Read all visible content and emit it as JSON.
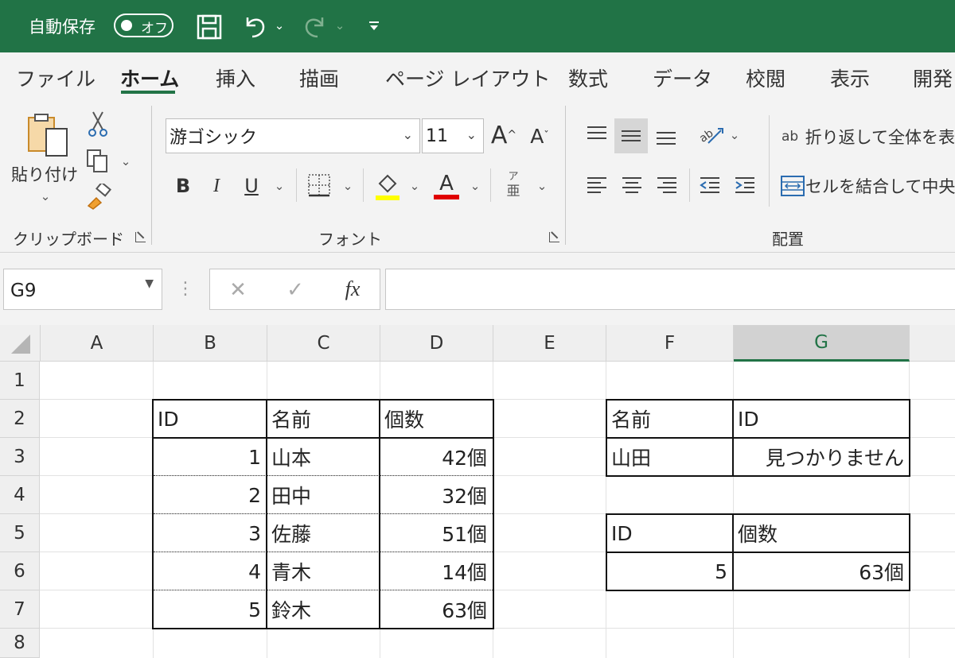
{
  "titlebar": {
    "autosave_label": "自動保存",
    "toggle_state": "オフ",
    "bg_color": "#217346"
  },
  "tabs": [
    "ファイル",
    "ホーム",
    "挿入",
    "描画",
    "ページ レイアウト",
    "数式",
    "データ",
    "校閲",
    "表示",
    "開発"
  ],
  "ribbon": {
    "clipboard": {
      "paste_label": "貼り付け",
      "group_label": "クリップボード"
    },
    "font": {
      "font_name": "游ゴシック",
      "font_size": "11",
      "bold": "B",
      "italic": "I",
      "underline": "U",
      "font_color_glyph": "A",
      "phonetic_top": "ア",
      "phonetic_bottom": "亜",
      "group_label": "フォント",
      "fill_color": "#ffff00",
      "font_color": "#e00000"
    },
    "alignment": {
      "wrap_text": "折り返して全体を表",
      "merge_center": "セルを結合して中央",
      "group_label": "配置",
      "wrap_icon_text": "ab"
    }
  },
  "formula_bar": {
    "name_box": "G9",
    "fx_label": "fx",
    "value": ""
  },
  "sheet": {
    "columns": [
      "A",
      "B",
      "C",
      "D",
      "E",
      "F",
      "G"
    ],
    "selected_column": "G",
    "rows": [
      "1",
      "2",
      "3",
      "4",
      "5",
      "6",
      "7",
      "8"
    ],
    "table1": {
      "headers": [
        "ID",
        "名前",
        "個数"
      ],
      "rows": [
        [
          "1",
          "山本",
          "42個"
        ],
        [
          "2",
          "田中",
          "32個"
        ],
        [
          "3",
          "佐藤",
          "51個"
        ],
        [
          "4",
          "青木",
          "14個"
        ],
        [
          "5",
          "鈴木",
          "63個"
        ]
      ]
    },
    "lookup1": {
      "headers": [
        "名前",
        "ID"
      ],
      "row": [
        "山田",
        "見つかりません"
      ]
    },
    "lookup2": {
      "headers": [
        "ID",
        "個数"
      ],
      "row": [
        "5",
        "63個"
      ]
    }
  }
}
